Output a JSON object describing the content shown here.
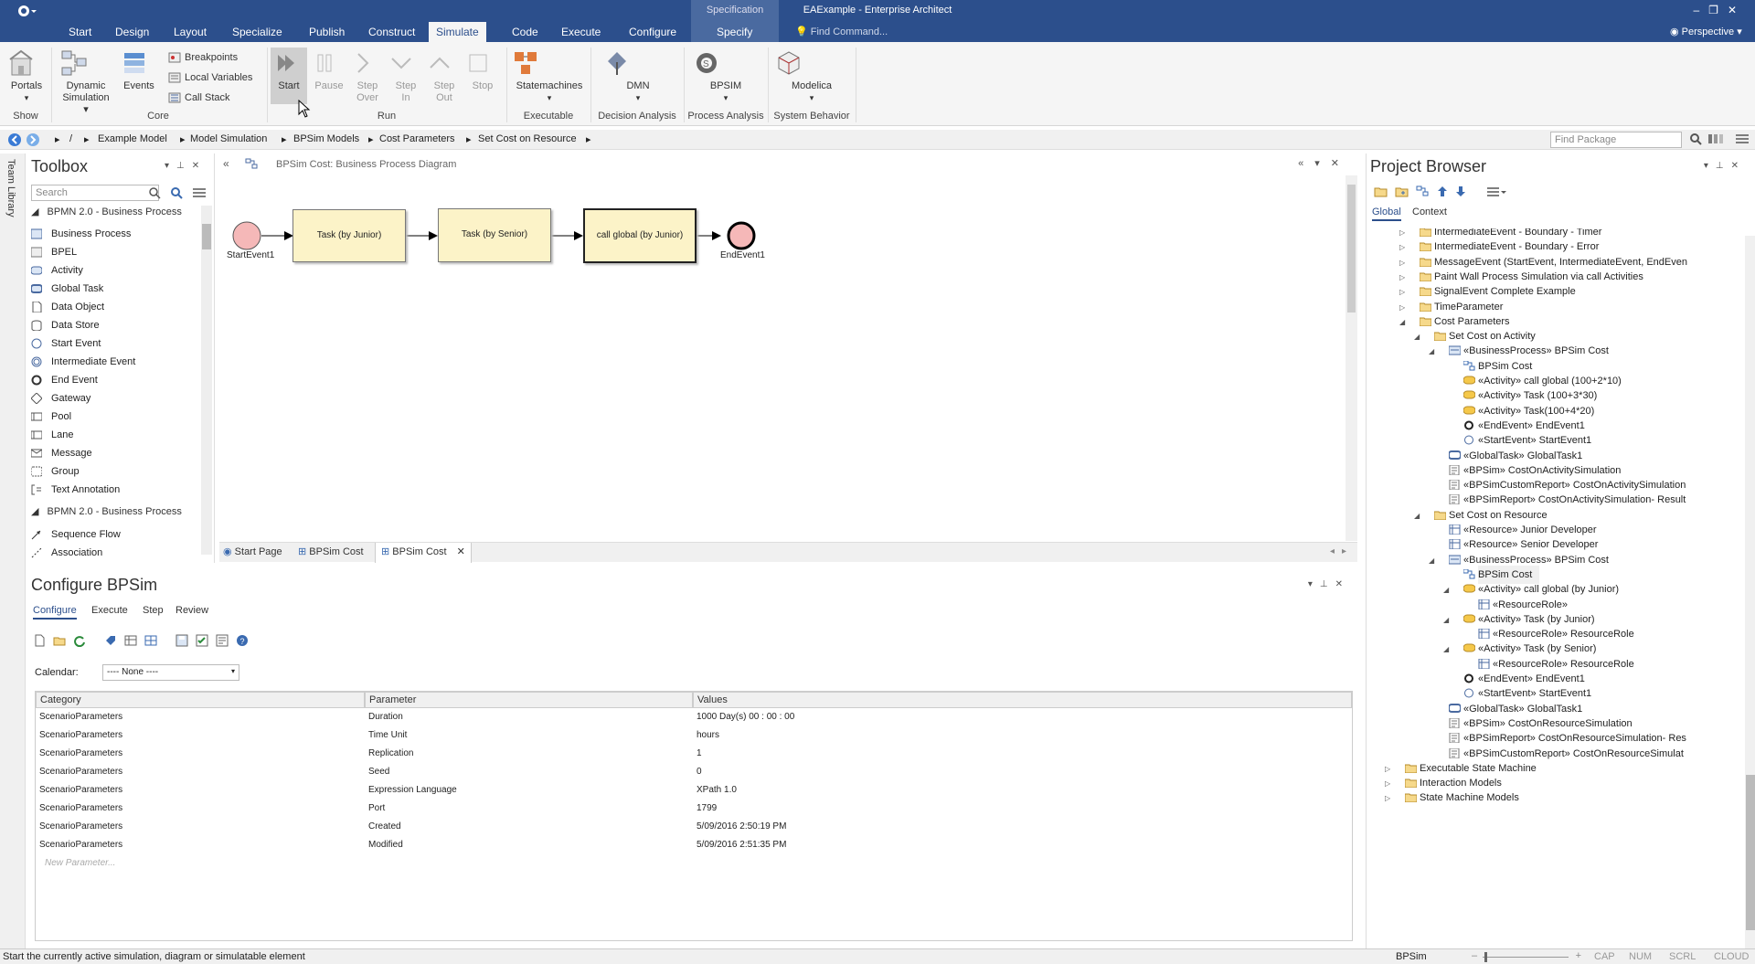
{
  "app_title": "EAExample - Enterprise Architect",
  "spec_tab": "Specification",
  "menu": [
    "Start",
    "Design",
    "Layout",
    "Specialize",
    "Publish",
    "Construct",
    "Simulate",
    "Code",
    "Execute",
    "Configure",
    "Specify"
  ],
  "find_command": "Find Command...",
  "perspective": "Perspective",
  "ribbon": {
    "portals": "Portals",
    "dynamic_sim": "Dynamic",
    "dynamic_sim2": "Simulation",
    "events": "Events",
    "breakpoints": "Breakpoints",
    "local_vars": "Local Variables",
    "call_stack": "Call Stack",
    "start": "Start",
    "pause": "Pause",
    "step_over": "Step",
    "step_over2": "Over",
    "step_in": "Step",
    "step_in2": "In",
    "step_out": "Step",
    "step_out2": "Out",
    "stop": "Stop",
    "statemachines": "Statemachines",
    "dmn": "DMN",
    "bpsim": "BPSIM",
    "modelica": "Modelica",
    "groups": {
      "show": "Show",
      "core": "Core",
      "run": "Run",
      "executable": "Executable",
      "decision": "Decision Analysis",
      "process": "Process Analysis",
      "system": "System Behavior"
    }
  },
  "breadcrumb": [
    "/",
    "Example Model",
    "Model Simulation",
    "BPSim Models",
    "Cost Parameters",
    "Set Cost on Resource"
  ],
  "find_package": "Find Package",
  "team_library": "Team Library",
  "toolbox": {
    "title": "Toolbox",
    "search": "Search",
    "section1": "BPMN 2.0 - Business Process",
    "items": [
      "Business Process",
      "BPEL",
      "Activity",
      "Global Task",
      "Data Object",
      "Data Store",
      "Start Event",
      "Intermediate Event",
      "End Event",
      "Gateway",
      "Pool",
      "Lane",
      "Message",
      "Group",
      "Text Annotation"
    ],
    "section2": "BPMN 2.0 - Business Process",
    "items2": [
      "Sequence Flow",
      "Association"
    ]
  },
  "diagram": {
    "title": "BPSim Cost:  Business Process Diagram",
    "start_event": "StartEvent1",
    "task1": "Task (by Junior)",
    "task2": "Task (by Senior)",
    "task3": "call global (by Junior)",
    "end_event": "EndEvent1",
    "tabs": [
      "Start Page",
      "BPSim Cost",
      "BPSim Cost"
    ]
  },
  "bpsim": {
    "title": "Configure BPSim",
    "tabs": [
      "Configure",
      "Execute",
      "Step",
      "Review"
    ],
    "calendar_label": "Calendar:",
    "calendar_value": "---- None ----",
    "headers": [
      "Category",
      "Parameter",
      "Values"
    ],
    "rows": [
      [
        "ScenarioParameters",
        "Duration",
        "1000 Day(s) 00 : 00 : 00"
      ],
      [
        "ScenarioParameters",
        "Time Unit",
        "hours"
      ],
      [
        "ScenarioParameters",
        "Replication",
        "1"
      ],
      [
        "ScenarioParameters",
        "Seed",
        "0"
      ],
      [
        "ScenarioParameters",
        "Expression Language",
        "XPath 1.0"
      ],
      [
        "ScenarioParameters",
        "Port",
        "1799"
      ],
      [
        "ScenarioParameters",
        "Created",
        "5/09/2016 2:50:19 PM"
      ],
      [
        "ScenarioParameters",
        "Modified",
        "5/09/2016 2:51:35 PM"
      ]
    ],
    "new_param": "New Parameter..."
  },
  "browser": {
    "title": "Project Browser",
    "tab_global": "Global",
    "tab_context": "Context",
    "nodes": [
      "IntermediateEvent - Boundary - Timer",
      "IntermediateEvent - Boundary - Error",
      "MessageEvent (StartEvent, IntermediateEvent, EndEven",
      "Paint Wall Process Simulation via call Activities",
      "SignalEvent Complete Example",
      "TimeParameter",
      "Cost Parameters",
      "Set Cost on Activity",
      "«BusinessProcess» BPSim Cost",
      "BPSim Cost",
      "«Activity» call global (100+2*10)",
      "«Activity» Task (100+3*30)",
      "«Activity» Task(100+4*20)",
      "«EndEvent» EndEvent1",
      "«StartEvent» StartEvent1",
      "«GlobalTask» GlobalTask1",
      "«BPSim» CostOnActivitySimulation",
      "«BPSimCustomReport» CostOnActivitySimulation",
      "«BPSimReport» CostOnActivitySimulation- Result",
      "Set Cost on Resource",
      "«Resource» Junior Developer",
      "«Resource» Senior Developer",
      "«BusinessProcess» BPSim Cost",
      "BPSim Cost",
      "«Activity» call global (by Junior)",
      "«ResourceRole»",
      "«Activity» Task (by Junior)",
      "«ResourceRole» ResourceRole",
      "«Activity» Task (by Senior)",
      "«ResourceRole» ResourceRole",
      "«EndEvent» EndEvent1",
      "«StartEvent» StartEvent1",
      "«GlobalTask» GlobalTask1",
      "«BPSim» CostOnResourceSimulation",
      "«BPSimReport» CostOnResourceSimulation- Res",
      "«BPSimCustomReport» CostOnResourceSimulat",
      "Executable State Machine",
      "Interaction Models",
      "State Machine Models"
    ]
  },
  "status": {
    "message": "Start the currently active simulation, diagram or simulatable element",
    "bpsim": "BPSim",
    "cap": "CAP",
    "num": "NUM",
    "scrl": "SCRL",
    "cloud": "CLOUD"
  }
}
